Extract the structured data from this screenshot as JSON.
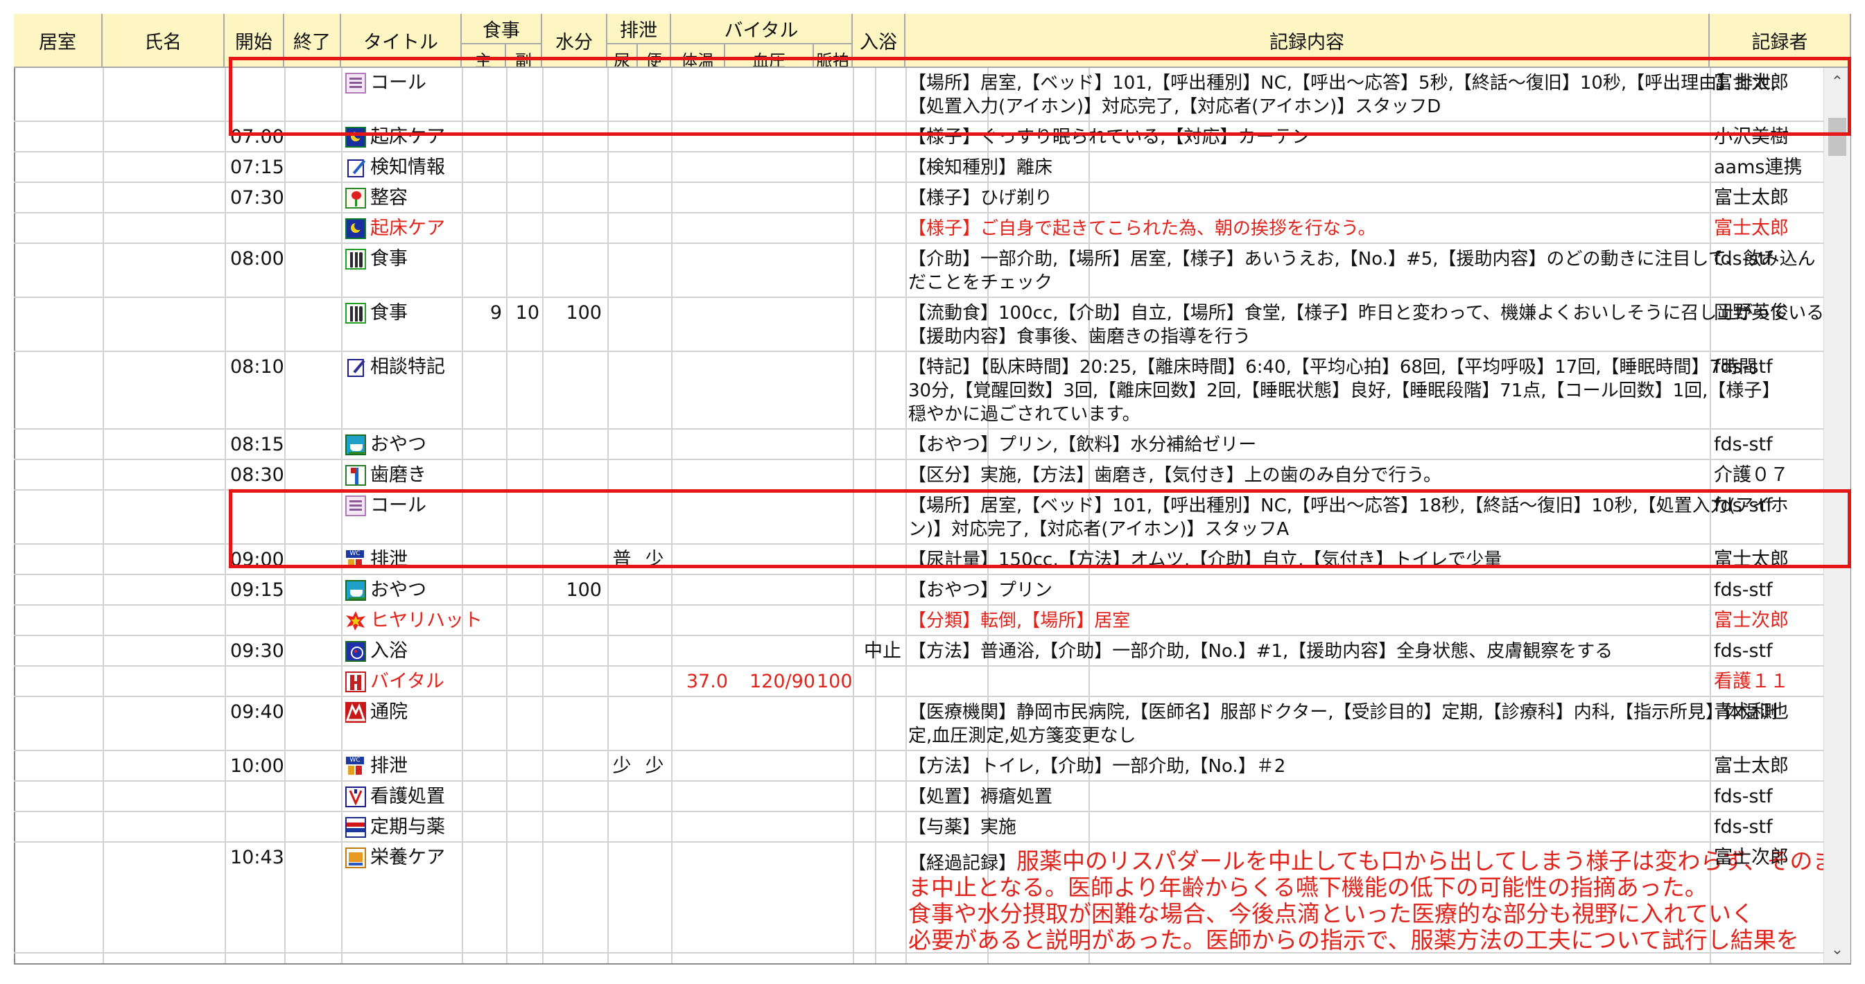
{
  "columns": {
    "room": "居室",
    "name": "氏名",
    "start": "開始",
    "end": "終了",
    "title": "タイトル",
    "meal": "食事",
    "meal_main": "主",
    "meal_side": "副",
    "water": "水分",
    "excretion": "排泄",
    "urine": "尿",
    "stool": "便",
    "vitals": "バイタル",
    "temp": "体温",
    "bp": "血圧",
    "pulse": "脈拍",
    "bath": "入浴",
    "record": "記録内容",
    "recorder": "記録者"
  },
  "rows": [
    {
      "start": "",
      "icon": "call-icon",
      "title": "コール",
      "meal_main": "",
      "meal_side": "",
      "water": "",
      "urine": "",
      "stool": "",
      "temp": "",
      "bp": "",
      "pulse": "",
      "bath": "",
      "record": [
        "【場所】居室,【ベッド】101,【呼出種別】NC,【呼出～応答】5秒,【終話～復旧】10秒,【呼出理由】排泄,",
        "【処置入力(アイホン)】対応完了,【対応者(アイホン)】スタッフD"
      ],
      "recorder": "富士太郎",
      "red": false
    },
    {
      "start": "07:00",
      "icon": "wakeup-care-icon",
      "title": "起床ケア",
      "meal_main": "",
      "meal_side": "",
      "water": "",
      "urine": "",
      "stool": "",
      "temp": "",
      "bp": "",
      "pulse": "",
      "bath": "",
      "record": [
        "【様子】ぐっすり眠られている,【対応】カーテン"
      ],
      "recorder": "小沢美樹",
      "red": false
    },
    {
      "start": "07:15",
      "icon": "sensor-info-icon",
      "title": "検知情報",
      "meal_main": "",
      "meal_side": "",
      "water": "",
      "urine": "",
      "stool": "",
      "temp": "",
      "bp": "",
      "pulse": "",
      "bath": "",
      "record": [
        "【検知種別】離床"
      ],
      "recorder": "aams連携",
      "red": false
    },
    {
      "start": "07:30",
      "icon": "grooming-icon",
      "title": "整容",
      "meal_main": "",
      "meal_side": "",
      "water": "",
      "urine": "",
      "stool": "",
      "temp": "",
      "bp": "",
      "pulse": "",
      "bath": "",
      "record": [
        "【様子】ひげ剃り"
      ],
      "recorder": "富士太郎",
      "red": false
    },
    {
      "start": "",
      "icon": "wakeup-care-icon",
      "title": "起床ケア",
      "meal_main": "",
      "meal_side": "",
      "water": "",
      "urine": "",
      "stool": "",
      "temp": "",
      "bp": "",
      "pulse": "",
      "bath": "",
      "record": [
        "【様子】ご自身で起きてこられた為、朝の挨拶を行なう。"
      ],
      "recorder": "富士太郎",
      "red": true
    },
    {
      "start": "08:00",
      "icon": "meal-icon",
      "title": "食事",
      "meal_main": "",
      "meal_side": "",
      "water": "",
      "urine": "",
      "stool": "",
      "temp": "",
      "bp": "",
      "pulse": "",
      "bath": "",
      "record": [
        "【介助】一部介助,【場所】居室,【様子】あいうえお,【No.】#5,【援助内容】のどの動きに注目して、飲み込ん",
        "だことをチェック"
      ],
      "recorder": "fds-stf",
      "red": false
    },
    {
      "start": "",
      "icon": "meal-icon",
      "title": "食事",
      "meal_main": "9",
      "meal_side": "10",
      "water": "100",
      "urine": "",
      "stool": "",
      "temp": "",
      "bp": "",
      "pulse": "",
      "bath": "",
      "record": [
        "【流動食】100cc,【介助】自立,【場所】食堂,【様子】昨日と変わって、機嫌よくおいしそうに召し上がっている,",
        "【援助内容】食事後、歯磨きの指導を行う"
      ],
      "recorder": "岡野英俊",
      "red": false
    },
    {
      "start": "08:10",
      "icon": "consult-note-icon",
      "title": "相談特記",
      "meal_main": "",
      "meal_side": "",
      "water": "",
      "urine": "",
      "stool": "",
      "temp": "",
      "bp": "",
      "pulse": "",
      "bath": "",
      "record": [
        "【特記】【臥床時間】20:25,【離床時間】6:40,【平均心拍】68回,【平均呼吸】17回,【睡眠時間】7時間",
        "30分,【覚醒回数】3回,【離床回数】2回,【睡眠状態】良好,【睡眠段階】71点,【コール回数】1回,【様子】",
        "穏やかに過ごされています。"
      ],
      "recorder": "fds-stf",
      "red": false
    },
    {
      "start": "08:15",
      "icon": "snack-icon",
      "title": "おやつ",
      "meal_main": "",
      "meal_side": "",
      "water": "",
      "urine": "",
      "stool": "",
      "temp": "",
      "bp": "",
      "pulse": "",
      "bath": "",
      "record": [
        "【おやつ】プリン,【飲料】水分補給ゼリー"
      ],
      "recorder": "fds-stf",
      "red": false
    },
    {
      "start": "08:30",
      "icon": "toothbrush-icon",
      "title": "歯磨き",
      "meal_main": "",
      "meal_side": "",
      "water": "",
      "urine": "",
      "stool": "",
      "temp": "",
      "bp": "",
      "pulse": "",
      "bath": "",
      "record": [
        "【区分】実施,【方法】歯磨き,【気付き】上の歯のみ自分で行う。"
      ],
      "recorder": "介護０７",
      "red": false
    },
    {
      "start": "",
      "icon": "call-icon",
      "title": "コール",
      "meal_main": "",
      "meal_side": "",
      "water": "",
      "urine": "",
      "stool": "",
      "temp": "",
      "bp": "",
      "pulse": "",
      "bath": "",
      "record": [
        "【場所】居室,【ベッド】101,【呼出種別】NC,【呼出～応答】18秒,【終話～復旧】10秒,【処置入力(アイホ",
        "ン)】対応完了,【対応者(アイホン)】スタッフA"
      ],
      "recorder": "fds-stf",
      "red": false
    },
    {
      "start": "09:00",
      "icon": "wc-icon",
      "title": "排泄",
      "meal_main": "",
      "meal_side": "",
      "water": "",
      "urine": "普",
      "stool": "少",
      "temp": "",
      "bp": "",
      "pulse": "",
      "bath": "",
      "record": [
        "【尿計量】150cc,【方法】オムツ,【介助】自立,【気付き】トイレで少量"
      ],
      "recorder": "富士太郎",
      "red": false
    },
    {
      "start": "09:15",
      "icon": "snack-icon",
      "title": "おやつ",
      "meal_main": "",
      "meal_side": "",
      "water": "100",
      "urine": "",
      "stool": "",
      "temp": "",
      "bp": "",
      "pulse": "",
      "bath": "",
      "record": [
        "【おやつ】プリン"
      ],
      "recorder": "fds-stf",
      "red": false
    },
    {
      "start": "",
      "icon": "near-miss-icon",
      "title": "ヒヤリハット",
      "meal_main": "",
      "meal_side": "",
      "water": "",
      "urine": "",
      "stool": "",
      "temp": "",
      "bp": "",
      "pulse": "",
      "bath": "",
      "record": [
        "【分類】転倒,【場所】居室"
      ],
      "recorder": "富士次郎",
      "red": true
    },
    {
      "start": "09:30",
      "icon": "bath-icon",
      "title": "入浴",
      "meal_main": "",
      "meal_side": "",
      "water": "",
      "urine": "",
      "stool": "",
      "temp": "",
      "bp": "",
      "pulse": "",
      "bath": "中止",
      "record": [
        "【方法】普通浴,【介助】一部介助,【No.】#1,【援助内容】全身状態、皮膚観察をする"
      ],
      "recorder": "fds-stf",
      "red": false
    },
    {
      "start": "",
      "icon": "vital-icon",
      "title": "バイタル",
      "meal_main": "",
      "meal_side": "",
      "water": "",
      "urine": "",
      "stool": "",
      "temp": "37.0",
      "bp": "120/90",
      "pulse": "100",
      "bath": "",
      "record": [
        ""
      ],
      "recorder": "看護１１",
      "red": true
    },
    {
      "start": "09:40",
      "icon": "hospital-visit-icon",
      "title": "通院",
      "meal_main": "",
      "meal_side": "",
      "water": "",
      "urine": "",
      "stool": "",
      "temp": "",
      "bp": "",
      "pulse": "",
      "bath": "",
      "record": [
        "【医療機関】静岡市民病院,【医師名】服部ドクター,【受診目的】定期,【診療科】内科,【指示所見】体温測",
        "定,血圧測定,処方箋変更なし"
      ],
      "recorder": "青木和也",
      "red": false
    },
    {
      "start": "10:00",
      "icon": "wc-icon",
      "title": "排泄",
      "meal_main": "",
      "meal_side": "",
      "water": "",
      "urine": "少",
      "stool": "少",
      "temp": "",
      "bp": "",
      "pulse": "",
      "bath": "",
      "record": [
        "【方法】トイレ,【介助】一部介助,【No.】＃2"
      ],
      "recorder": "富士太郎",
      "red": false
    },
    {
      "start": "",
      "icon": "nursing-care-icon",
      "title": "看護処置",
      "meal_main": "",
      "meal_side": "",
      "water": "",
      "urine": "",
      "stool": "",
      "temp": "",
      "bp": "",
      "pulse": "",
      "bath": "",
      "record": [
        "【処置】褥瘡処置"
      ],
      "recorder": "fds-stf",
      "red": false
    },
    {
      "start": "",
      "icon": "medication-icon",
      "title": "定期与薬",
      "meal_main": "",
      "meal_side": "",
      "water": "",
      "urine": "",
      "stool": "",
      "temp": "",
      "bp": "",
      "pulse": "",
      "bath": "",
      "record": [
        "【与薬】実施"
      ],
      "recorder": "fds-stf",
      "red": false
    },
    {
      "start": "10:43",
      "icon": "nutrition-care-icon",
      "title": "栄養ケア",
      "meal_main": "",
      "meal_side": "",
      "water": "",
      "urine": "",
      "stool": "",
      "temp": "",
      "bp": "",
      "pulse": "",
      "bath": "",
      "record_label": "【経過記録】",
      "record": [
        "服薬中のリスパダールを中止しても口から出してしまう様子は変わらず、そのま",
        "ま中止となる。医師より年齢からくる嚥下機能の低下の可能性の指摘あった。",
        "食事や水分摂取が困難な場合、今後点滴といった医療的な部分も視野に入れていく",
        "必要があると説明があった。医師からの指示で、服薬方法の工夫について試行し結果を"
      ],
      "recorder": "富士次郎",
      "red": false
    }
  ],
  "colors": {
    "header_bg": "#fdf5c2",
    "highlight": "#e51616",
    "red_text": "#e0231b"
  }
}
